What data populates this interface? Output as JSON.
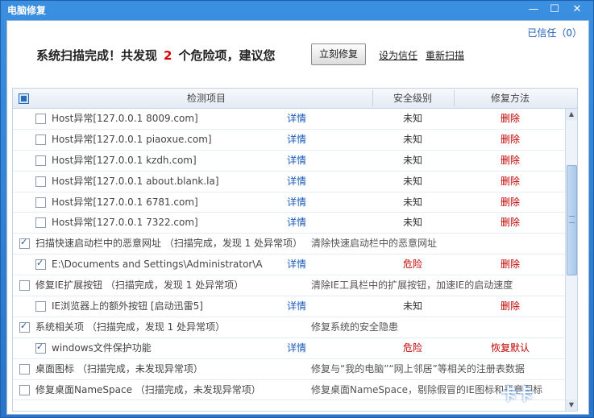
{
  "window": {
    "title": "电脑修复",
    "min": "—",
    "max": "☐",
    "close": "✕"
  },
  "trust": {
    "label": "已信任（0）"
  },
  "headline": {
    "prefix": "系统扫描完成！共发现",
    "count": "2",
    "suffix": "个危险项，建议您"
  },
  "actions": {
    "fix_now": "立刻修复",
    "set_trust": "设为信任",
    "rescan": "重新扫描"
  },
  "columns": {
    "item": "检测项目",
    "level": "安全级别",
    "method": "修复方法"
  },
  "rows": [
    {
      "type": "sub",
      "checked": false,
      "name": "Host异常[127.0.0.1 8009.com]",
      "detail": "详情",
      "level": "未知",
      "fix": "删除"
    },
    {
      "type": "sub",
      "checked": false,
      "name": "Host异常[127.0.0.1 piaoxue.com]",
      "detail": "详情",
      "level": "未知",
      "fix": "删除"
    },
    {
      "type": "sub",
      "checked": false,
      "name": "Host异常[127.0.0.1 kzdh.com]",
      "detail": "详情",
      "level": "未知",
      "fix": "删除"
    },
    {
      "type": "sub",
      "checked": false,
      "name": "Host异常[127.0.0.1 about.blank.la]",
      "detail": "详情",
      "level": "未知",
      "fix": "删除"
    },
    {
      "type": "sub",
      "checked": false,
      "name": "Host异常[127.0.0.1 6781.com]",
      "detail": "详情",
      "level": "未知",
      "fix": "删除"
    },
    {
      "type": "sub",
      "checked": false,
      "name": "Host异常[127.0.0.1 7322.com]",
      "detail": "详情",
      "level": "未知",
      "fix": "删除"
    },
    {
      "type": "group",
      "checked": true,
      "name": "扫描快速启动栏中的恶意网址 （扫描完成，发现 1 处异常项）",
      "desc": "清除快速启动栏中的恶意网址"
    },
    {
      "type": "sub",
      "checked": true,
      "name": "E:\\Documents and Settings\\Administrator\\Applicati...",
      "detail": "详情",
      "level": "危险",
      "fix": "删除"
    },
    {
      "type": "group",
      "checked": false,
      "name": "修复IE扩展按钮 （扫描完成，发现 1 处异常项）",
      "desc": "清除IE工具栏中的扩展按钮，加速IE的启动速度"
    },
    {
      "type": "sub",
      "checked": false,
      "name": "IE浏览器上的额外按钮 [启动迅雷5]",
      "detail": "详情",
      "level": "未知",
      "fix": "删除"
    },
    {
      "type": "group",
      "checked": true,
      "name": "系统相关项 （扫描完成，发现 1 处异常项）",
      "desc": "修复系统的安全隐患"
    },
    {
      "type": "sub",
      "checked": true,
      "name": "windows文件保护功能",
      "detail": "详情",
      "level": "危险",
      "fix": "恢复默认"
    },
    {
      "type": "group",
      "checked": false,
      "name": "桌面图标 （扫描完成，未发现异常项）",
      "desc": "修复与“我的电脑”“网上邻居”等相关的注册表数据"
    },
    {
      "type": "group",
      "checked": false,
      "name": "修复桌面NameSpace （扫描完成，未发现异常项）",
      "desc": "修复桌面NameSpace，剔除假冒的IE图标和恶意图标"
    }
  ],
  "watermark": "卡卡 www.ikaka.com"
}
